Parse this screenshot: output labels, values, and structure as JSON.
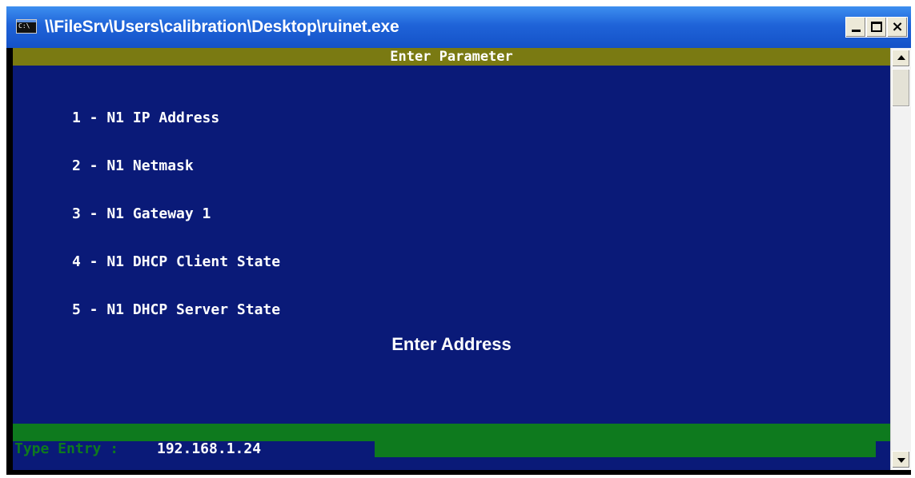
{
  "window": {
    "title": "\\\\FileSrv\\Users\\calibration\\Desktop\\ruinet.exe",
    "icon_text": "C:\\",
    "close_label": "×"
  },
  "console": {
    "header": "Enter Parameter",
    "menu_items": [
      "1 - N1 IP Address",
      "2 - N1 Netmask",
      "3 - N1 Gateway 1",
      "4 - N1 DHCP Client State",
      "5 - N1 DHCP Server State"
    ],
    "prompt": "Enter Address",
    "entry_label": "Type Entry : ",
    "entry_value": "192.168.1.24"
  },
  "colors": {
    "console_bg": "#0a1a78",
    "header_bg": "#7a7a12",
    "entry_green": "#0e7a1e",
    "titlebar_blue": "#1f63d8"
  }
}
